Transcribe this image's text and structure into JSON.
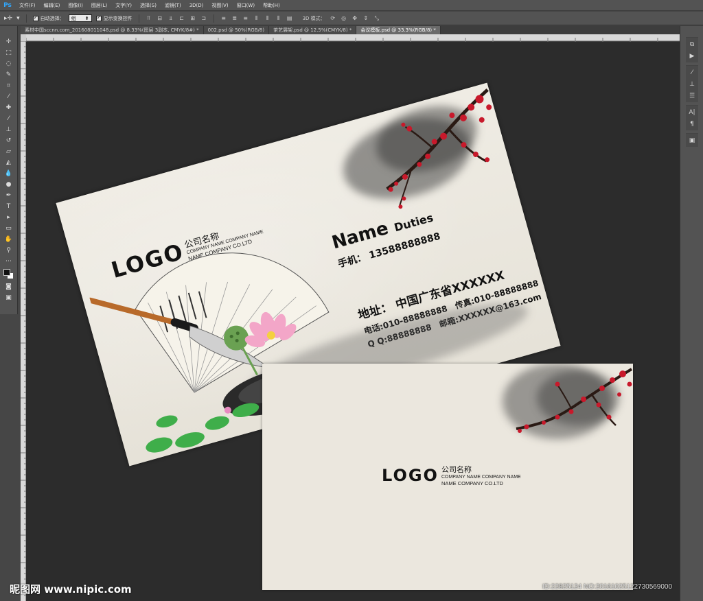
{
  "app": {
    "logo": "Ps",
    "menu": [
      "文件(F)",
      "编辑(E)",
      "图像(I)",
      "图层(L)",
      "文字(Y)",
      "选择(S)",
      "滤镜(T)",
      "3D(D)",
      "视图(V)",
      "窗口(W)",
      "帮助(H)"
    ]
  },
  "options": {
    "auto_select_label": "自动选择：",
    "auto_select_value": "组",
    "show_transform_label": "显示变换控件",
    "mode_3d_label": "3D 模式："
  },
  "tabs": [
    {
      "label": "素材中国sccnn.com_201608011048.psd @ 8.33%(图层 3副本, CMYK/8#) *"
    },
    {
      "label": "002.psd @ 50%(RGB/8)"
    },
    {
      "label": "茶艺展架.psd @ 12.5%(CMYK/8) *"
    },
    {
      "label": "会议模板.psd @ 33.3%(RGB/8) *"
    }
  ],
  "card_front": {
    "logo": "LOGO",
    "company_cn": "公司名称",
    "company_en_1": "COMPANY NAME COMPANY NAME",
    "company_en_2": "NAME COMPANY CO.LTD",
    "name": "Name",
    "duties": "Duties",
    "mobile_label": "手机：",
    "mobile": "13588888888",
    "address_label": "地址：",
    "address": "中国广东省XXXXXX",
    "tel": "电话:010-88888888",
    "fax": "传真:010-88888888",
    "qq": "Q Q:88888888",
    "email": "邮箱:XXXXXX@163.com"
  },
  "card_back": {
    "logo": "LOGO",
    "company_cn": "公司名称",
    "company_en_1": "COMPANY NAME COMPANY NAME",
    "company_en_2": "NAME COMPANY CO.LTD"
  },
  "watermark": {
    "site": "昵图网 www.nipic.com",
    "id": "ID:22825124 NO:20161025122730569000"
  },
  "colors": {
    "plum": "#c8192b",
    "ink": "#121212",
    "paper": "#ece9e0",
    "canvas": "#2c2c2c"
  }
}
